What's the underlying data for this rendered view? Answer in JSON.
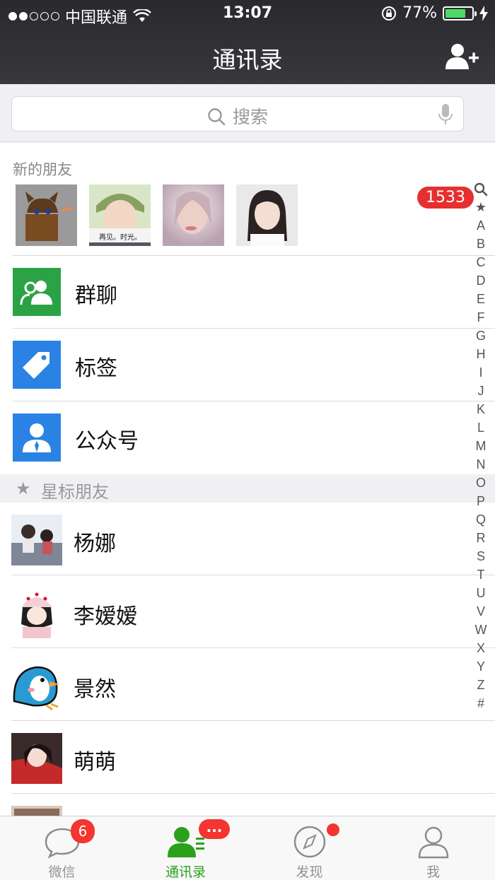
{
  "status_bar": {
    "carrier": "中国联通",
    "time": "13:07",
    "battery_percent": "77%",
    "battery_level": 0.77
  },
  "nav": {
    "title": "通讯录",
    "add_icon": "add-contact-icon"
  },
  "search": {
    "placeholder": "搜索"
  },
  "new_friends": {
    "label": "新的朋友",
    "badge": "1533",
    "avatar_caption": "再见。时光。"
  },
  "menu_items": [
    {
      "label": "群聊",
      "icon": "group-chat-icon",
      "color": "#2ba245"
    },
    {
      "label": "标签",
      "icon": "tag-icon",
      "color": "#2a82e4"
    },
    {
      "label": "公众号",
      "icon": "official-account-icon",
      "color": "#2a82e4"
    }
  ],
  "starred_section": {
    "label": "星标朋友",
    "icon": "star-icon"
  },
  "contacts": [
    {
      "name": "杨娜"
    },
    {
      "name": "李嫒嫒"
    },
    {
      "name": "景然"
    },
    {
      "name": "萌萌"
    }
  ],
  "index_letters": [
    "★",
    "A",
    "B",
    "C",
    "D",
    "E",
    "F",
    "G",
    "H",
    "I",
    "J",
    "K",
    "L",
    "M",
    "N",
    "O",
    "P",
    "Q",
    "R",
    "S",
    "T",
    "U",
    "V",
    "W",
    "X",
    "Y",
    "Z",
    "#"
  ],
  "tabs": [
    {
      "label": "微信",
      "badge": "6",
      "icon": "chat-bubble-icon"
    },
    {
      "label": "通讯录",
      "badge": "...",
      "icon": "contacts-icon",
      "active": true
    },
    {
      "label": "发现",
      "badge": "",
      "icon": "compass-icon"
    },
    {
      "label": "我",
      "badge": "",
      "icon": "person-icon"
    }
  ],
  "colors": {
    "accent_green": "#2aa11b",
    "badge_red": "#e6302f"
  }
}
